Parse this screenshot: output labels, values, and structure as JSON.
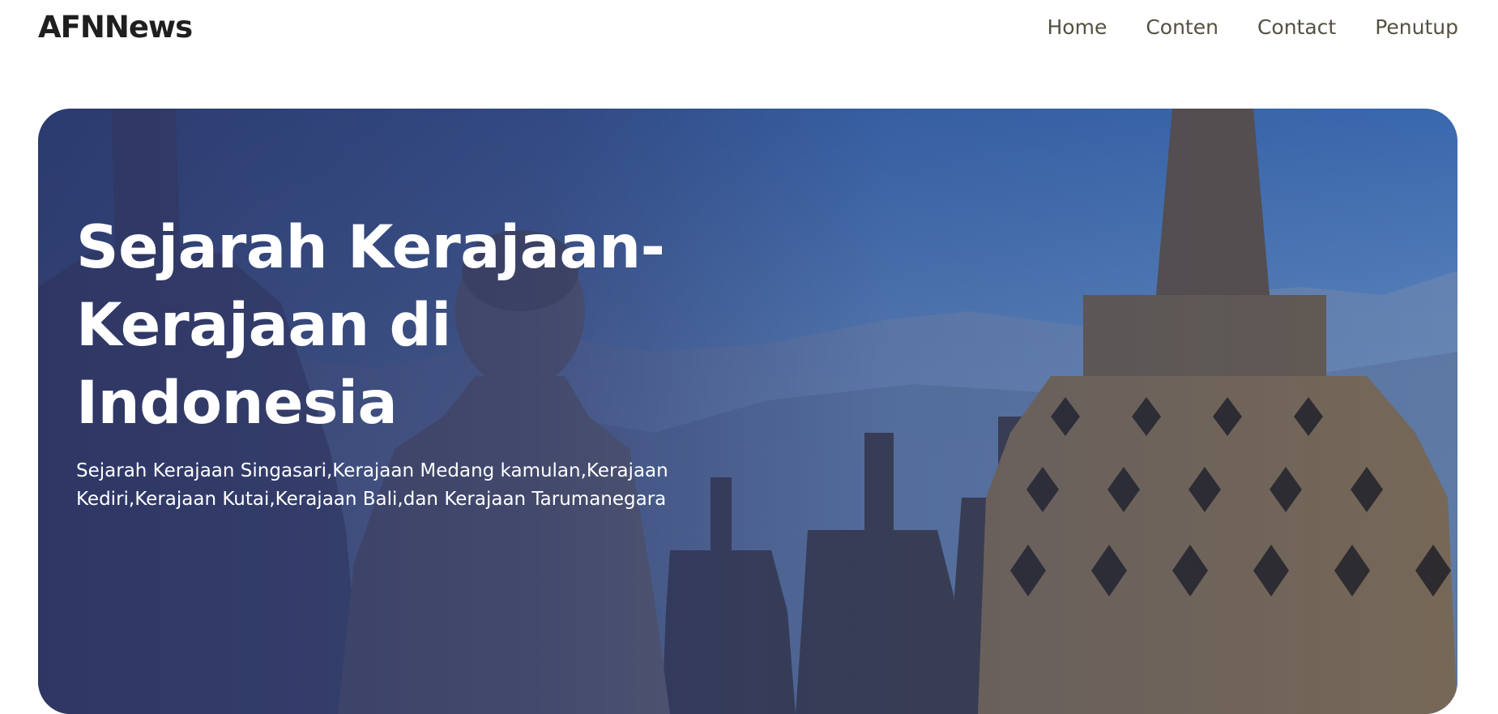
{
  "brand": "AFNNews",
  "nav": {
    "items": [
      {
        "label": "Home"
      },
      {
        "label": "Conten"
      },
      {
        "label": "Contact"
      },
      {
        "label": "Penutup"
      }
    ]
  },
  "hero": {
    "title": "Sejarah Kerajaan-Kerajaan di Indonesia",
    "subtitle": "Sejarah Kerajaan Singasari,Kerajaan Medang kamulan,Kerajaan Kediri,Kerajaan Kutai,Kerajaan Bali,dan Kerajaan Tarumanegara",
    "image": "borobudur-stupa-buddha-photo"
  },
  "colors": {
    "brand_text": "#1f1f1f",
    "nav_text": "#555142",
    "hero_overlay": "#2d3769",
    "hero_text": "#ffffff"
  }
}
